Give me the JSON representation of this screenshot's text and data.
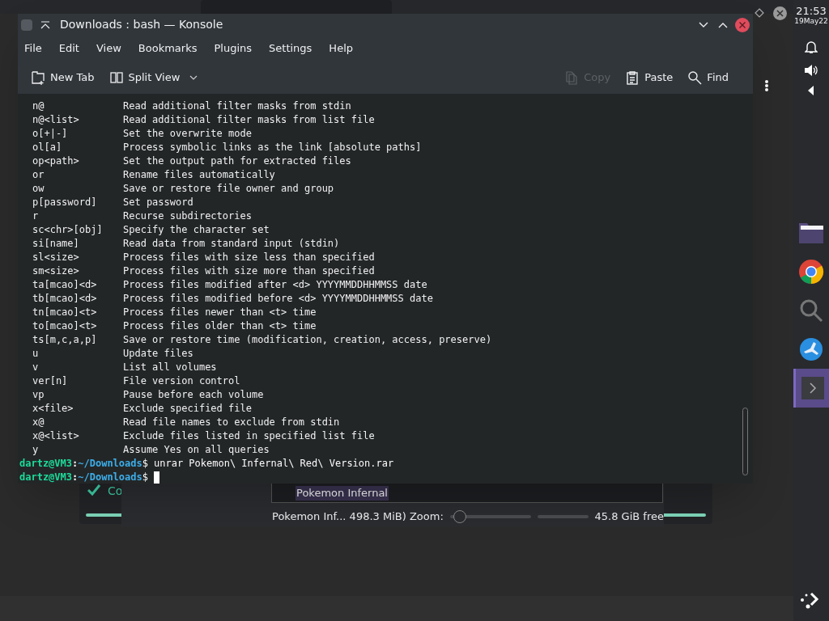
{
  "clock": {
    "time": "21:53",
    "date": "19May22"
  },
  "window": {
    "title": "Downloads : bash — Konsole"
  },
  "menu": [
    "File",
    "Edit",
    "View",
    "Bookmarks",
    "Plugins",
    "Settings",
    "Help"
  ],
  "toolbar": [
    {
      "label": "New Tab",
      "kind": "newtab",
      "disabled": false
    },
    {
      "label": "Split View",
      "kind": "split",
      "disabled": false
    },
    {
      "label": "Copy",
      "kind": "copy",
      "disabled": true
    },
    {
      "label": "Paste",
      "kind": "paste",
      "disabled": false
    },
    {
      "label": "Find",
      "kind": "find",
      "disabled": false
    }
  ],
  "terminal": {
    "options": [
      {
        "switch": "n@",
        "text": "Read additional filter masks from stdin"
      },
      {
        "switch": "n@<list>",
        "text": "Read additional filter masks from list file"
      },
      {
        "switch": "o[+|-]",
        "text": "Set the overwrite mode"
      },
      {
        "switch": "ol[a]",
        "text": "Process symbolic links as the link [absolute paths]"
      },
      {
        "switch": "op<path>",
        "text": "Set the output path for extracted files"
      },
      {
        "switch": "or",
        "text": "Rename files automatically"
      },
      {
        "switch": "ow",
        "text": "Save or restore file owner and group"
      },
      {
        "switch": "p[password]",
        "text": "Set password"
      },
      {
        "switch": "r",
        "text": "Recurse subdirectories"
      },
      {
        "switch": "sc<chr>[obj]",
        "text": "Specify the character set"
      },
      {
        "switch": "si[name]",
        "text": "Read data from standard input (stdin)"
      },
      {
        "switch": "sl<size>",
        "text": "Process files with size less than specified"
      },
      {
        "switch": "sm<size>",
        "text": "Process files with size more than specified"
      },
      {
        "switch": "ta[mcao]<d>",
        "text": "Process files modified after <d> YYYYMMDDHHMMSS date"
      },
      {
        "switch": "tb[mcao]<d>",
        "text": "Process files modified before <d> YYYYMMDDHHMMSS date"
      },
      {
        "switch": "tn[mcao]<t>",
        "text": "Process files newer than <t> time"
      },
      {
        "switch": "to[mcao]<t>",
        "text": "Process files older than <t> time"
      },
      {
        "switch": "ts[m,c,a,p]",
        "text": "Save or restore time (modification, creation, access, preserve)"
      },
      {
        "switch": "u",
        "text": "Update files"
      },
      {
        "switch": "v",
        "text": "List all volumes"
      },
      {
        "switch": "ver[n]",
        "text": "File version control"
      },
      {
        "switch": "vp",
        "text": "Pause before each volume"
      },
      {
        "switch": "x<file>",
        "text": "Exclude specified file"
      },
      {
        "switch": "x@",
        "text": "Read file names to exclude from stdin"
      },
      {
        "switch": "x@<list>",
        "text": "Exclude files listed in specified list file"
      },
      {
        "switch": "y",
        "text": "Assume Yes on all queries"
      }
    ],
    "prompts": [
      {
        "user": "dartz@VM3",
        "separator": ":",
        "path": "~/Downloads",
        "symbol": "$",
        "command": "unrar Pokemon\\ Infernal\\ Red\\ Version.rar",
        "cursor": false
      },
      {
        "user": "dartz@VM3",
        "separator": ":",
        "path": "~/Downloads",
        "symbol": "$",
        "cursor": true
      }
    ]
  },
  "background_dialog": {
    "check_label": "Co",
    "list_item": "Pokemon Infernal",
    "status": "Pokemon Inf... 498.3 MiB) Zoom:",
    "zoom": {
      "level": 0.05
    },
    "free": "45.8 GiB free"
  },
  "dock": [
    {
      "kind": "folder",
      "selected": false
    },
    {
      "kind": "browser",
      "selected": false
    },
    {
      "kind": "search",
      "selected": false
    },
    {
      "kind": "bird",
      "selected": false
    },
    {
      "kind": "terminal",
      "selected": true
    }
  ]
}
